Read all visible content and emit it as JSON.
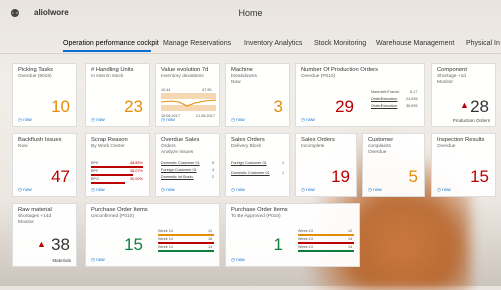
{
  "header": {
    "brand": "aliolwore",
    "title": "Home"
  },
  "tabs": [
    {
      "label": "Operation performance cockpit",
      "active": true
    },
    {
      "label": "Manage Reservations"
    },
    {
      "label": "Inventory Analytics"
    },
    {
      "label": "Stock Monitoring"
    },
    {
      "label": "Warehouse Management"
    },
    {
      "label": "Physical In"
    }
  ],
  "tiles": {
    "picking": {
      "title": "Picking Tasks",
      "sub": "Overdue (9015)",
      "value": "10",
      "foot": "now"
    },
    "handling": {
      "title": "# Handling Units",
      "sub": "In interim stock",
      "value": "23",
      "foot": "now"
    },
    "value_evo": {
      "title": "Value evolution 7d",
      "sub": "Inventory deviations",
      "v1": "10,44",
      "v2": "47,95",
      "d1": "15.06.2017",
      "d2": "21.06.2017",
      "foot": "now"
    },
    "machine": {
      "title": "Machine",
      "sub1": "breakdowns",
      "sub2": "Now",
      "value": "3",
      "foot": "now"
    },
    "production": {
      "title": "Number Of Production Orders",
      "sub": "Overdue (P010)",
      "value": "29",
      "rows": [
        {
          "label": "MaterialInTransit",
          "val": "8,17"
        },
        {
          "label": "OrderExecution",
          "val": "24,835"
        },
        {
          "label": "OrderExecution",
          "val": "36,595"
        }
      ],
      "foot": "now"
    },
    "component": {
      "title": "Component",
      "sub1": "Shortage +1d",
      "sub2": "Monitor",
      "value": "28",
      "foot_right": "Production Orders"
    },
    "backflush": {
      "title": "Backflush Issues",
      "sub": "Now",
      "value": "47",
      "foot": "now"
    },
    "scrap": {
      "title": "Scrap Reason",
      "sub": "By Work Center",
      "rows": [
        {
          "label": "BPE",
          "val": "48,85%"
        },
        {
          "label": "BPF",
          "val": "38,07%"
        },
        {
          "label": "BPG",
          "val": "30,00%"
        }
      ],
      "foot": "now"
    },
    "overdue_sales": {
      "title": "Overdue Sales",
      "sub1": "Orders",
      "sub2": "Analyze Issues",
      "rows": [
        {
          "label": "Domestic Customer 01",
          "val": "5"
        },
        {
          "label": "Foreign Customer 01",
          "val": "4"
        },
        {
          "label": "Domestic Int Busin.",
          "val": "2"
        }
      ],
      "foot": "now"
    },
    "sales_orders": {
      "title": "Sales Orders",
      "sub": "Delivery Block",
      "rows": [
        {
          "label": "Foreign Customer 01",
          "val": "1"
        },
        {
          "label": "Domestic Customer 01",
          "val": "1"
        }
      ],
      "foot": "now"
    },
    "sales_incomplete": {
      "title": "Sales Orders",
      "sub": "Incomplete",
      "value": "19",
      "foot": "now"
    },
    "complaints": {
      "title": "Customer",
      "sub1": "complaints",
      "sub2": "Overdue",
      "value": "5",
      "foot": "now"
    },
    "inspection": {
      "title": "Inspection Results",
      "sub": "Overdue",
      "value": "15",
      "foot": "now"
    },
    "raw_material": {
      "title": "Raw material",
      "sub1": "shortages +14d",
      "sub2": "Monitor",
      "value": "38",
      "foot_right": "Materials"
    },
    "po_unconfirmed": {
      "title": "Purchase Order Items",
      "sub": "Unconfirmed (P010)",
      "value": "15",
      "foot": "now"
    },
    "po_approved": {
      "title": "Purchase Order Items",
      "sub": "To Be Approved (P010)",
      "value": "1",
      "rows": [
        {
          "label": "Week 14",
          "val": "12"
        },
        {
          "label": "Week 14",
          "val": "14"
        },
        {
          "label": "Week 14",
          "val": "14"
        }
      ],
      "foot": "now"
    },
    "po_unconfirmed_rows": [
      {
        "label": "Week 14",
        "val": "12"
      },
      {
        "label": "Week 14",
        "val": "16"
      },
      {
        "label": "Week 14",
        "val": "14"
      }
    ]
  },
  "colors": {
    "accent": "#0a6ed1",
    "orange": "#e78c07",
    "red": "#bb0000",
    "green": "#107e3e"
  }
}
